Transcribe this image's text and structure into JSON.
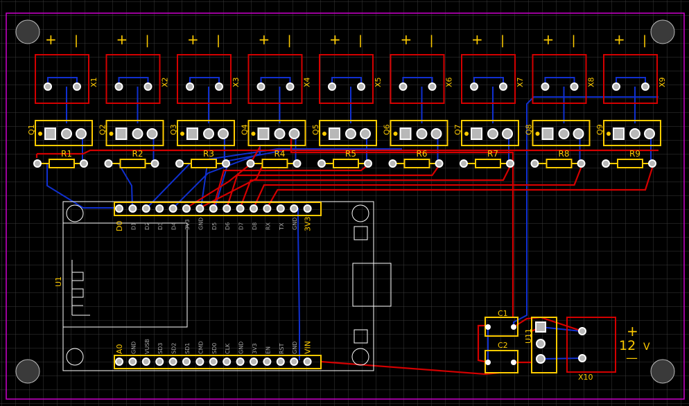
{
  "colors": {
    "background": "#000000",
    "grid": "#3a3a3a",
    "outline": "#c000c0",
    "silk": "#ffcc00",
    "top_copper": "#d40000",
    "bottom_copper": "#1030d0",
    "pad": "#ffffff",
    "hole": "#b8b8b8",
    "label_grey": "#a8a8a8"
  },
  "terminals": [
    {
      "label": "X1",
      "plus": "+",
      "minus": "|"
    },
    {
      "label": "X2",
      "plus": "+",
      "minus": "|"
    },
    {
      "label": "X3",
      "plus": "+",
      "minus": "|"
    },
    {
      "label": "X4",
      "plus": "+",
      "minus": "|"
    },
    {
      "label": "X5",
      "plus": "+",
      "minus": "|"
    },
    {
      "label": "X6",
      "plus": "+",
      "minus": "|"
    },
    {
      "label": "X7",
      "plus": "+",
      "minus": "|"
    },
    {
      "label": "X8",
      "plus": "+",
      "minus": "|"
    },
    {
      "label": "X9",
      "plus": "+",
      "minus": "|"
    }
  ],
  "transistors": [
    "Q1",
    "Q2",
    "Q3",
    "Q4",
    "Q5",
    "Q6",
    "Q7",
    "Q8",
    "Q9"
  ],
  "resistors": [
    "R1",
    "R2",
    "R3",
    "R4",
    "R5",
    "R6",
    "R7",
    "R8",
    "R9"
  ],
  "module": {
    "label": "U1",
    "top_pins": [
      "D0",
      "D1",
      "D2",
      "D3",
      "D4",
      "3V3",
      "GND",
      "D5",
      "D6",
      "D7",
      "D8",
      "RX",
      "TX",
      "GND",
      "3V3"
    ],
    "bottom_pins": [
      "A0",
      "GND",
      "VUSB",
      "SD3",
      "SD2",
      "SD1",
      "CMD",
      "SD0",
      "CLK",
      "GND",
      "3V3",
      "EN",
      "RST",
      "GND",
      "VIN"
    ]
  },
  "capacitors": [
    "C1",
    "C2"
  ],
  "regulator": {
    "label": "U11"
  },
  "power_terminal": {
    "label": "X10",
    "voltage": "12",
    "unit": "V",
    "plus": "+",
    "minus": "—"
  }
}
